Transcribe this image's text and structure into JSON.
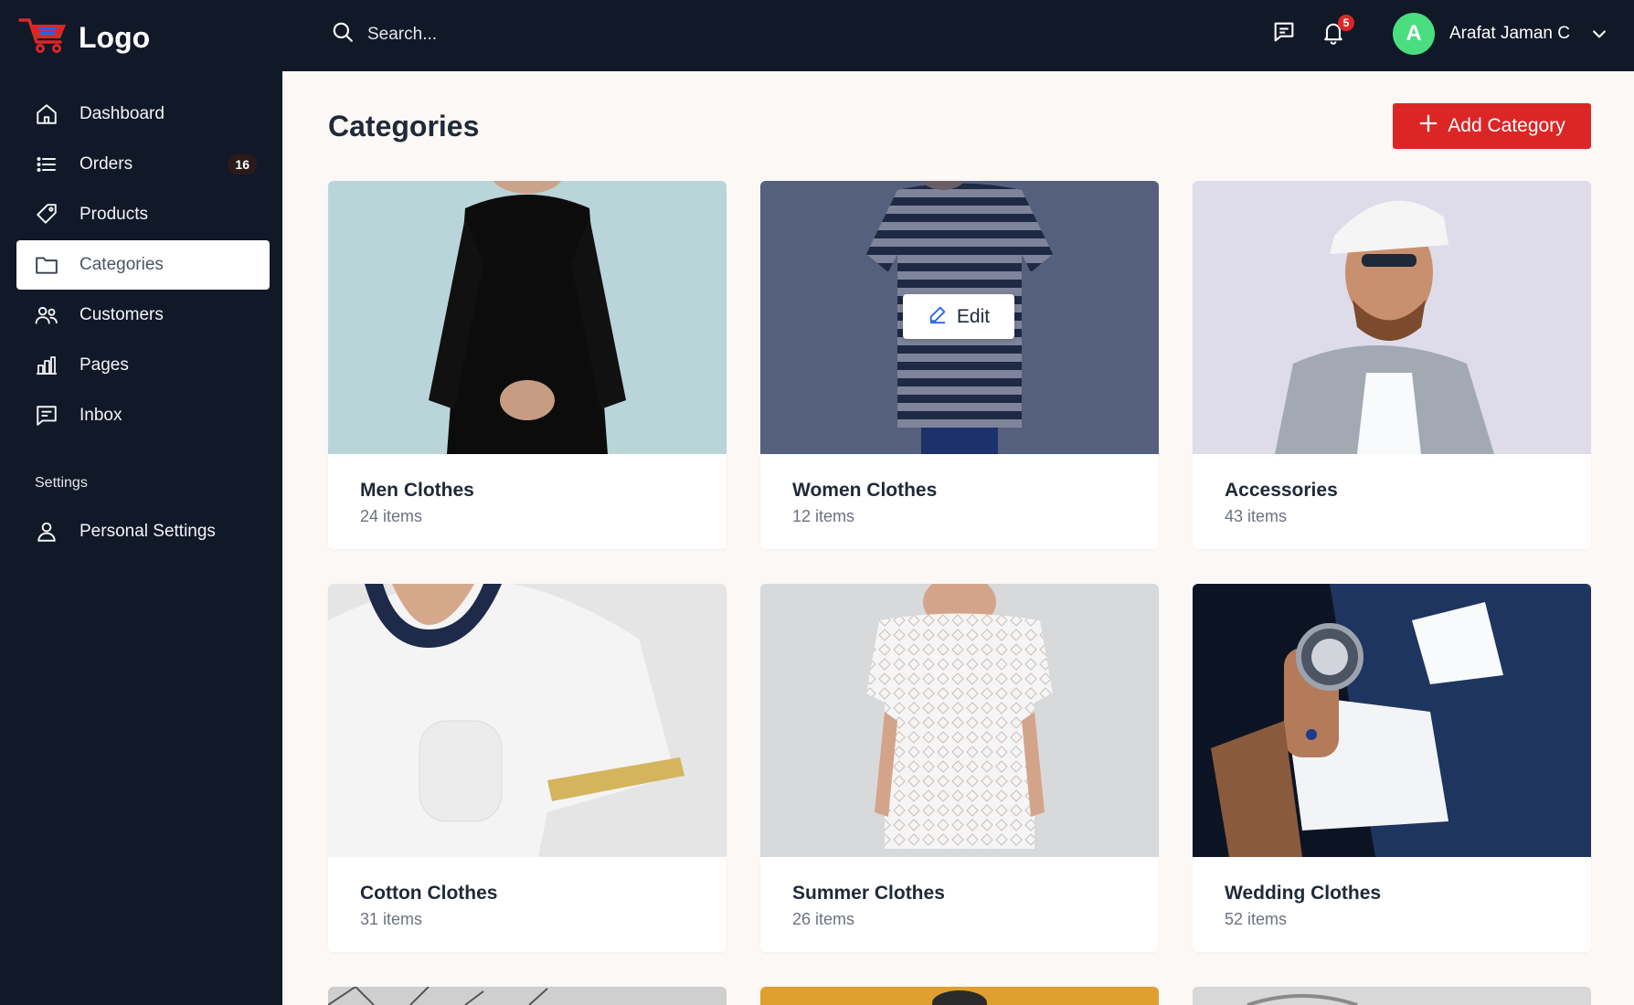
{
  "brand": {
    "logo_text": "Logo",
    "logo_icon": "shopping-cart-icon",
    "accent": "#dc2626"
  },
  "search": {
    "placeholder": "Search..."
  },
  "header": {
    "notifications_count": "5",
    "user_initial": "A",
    "user_name": "Arafat Jaman C"
  },
  "sidebar": {
    "items": [
      {
        "label": "Dashboard",
        "icon": "home-icon"
      },
      {
        "label": "Orders",
        "icon": "list-icon",
        "badge": "16"
      },
      {
        "label": "Products",
        "icon": "tag-icon"
      },
      {
        "label": "Categories",
        "icon": "folder-icon",
        "active": true
      },
      {
        "label": "Customers",
        "icon": "users-icon"
      },
      {
        "label": "Pages",
        "icon": "chart-icon"
      },
      {
        "label": "Inbox",
        "icon": "message-icon"
      }
    ],
    "settings_heading": "Settings",
    "settings_items": [
      {
        "label": "Personal Settings",
        "icon": "user-icon"
      }
    ]
  },
  "main": {
    "title": "Categories",
    "add_button_label": "Add Category",
    "edit_label": "Edit",
    "categories": [
      {
        "name": "Men Clothes",
        "count": "24 items"
      },
      {
        "name": "Women Clothes",
        "count": "12 items"
      },
      {
        "name": "Accessories",
        "count": "43 items"
      },
      {
        "name": "Cotton Clothes",
        "count": "31 items"
      },
      {
        "name": "Summer Clothes",
        "count": "26 items"
      },
      {
        "name": "Wedding Clothes",
        "count": "52 items"
      }
    ]
  }
}
